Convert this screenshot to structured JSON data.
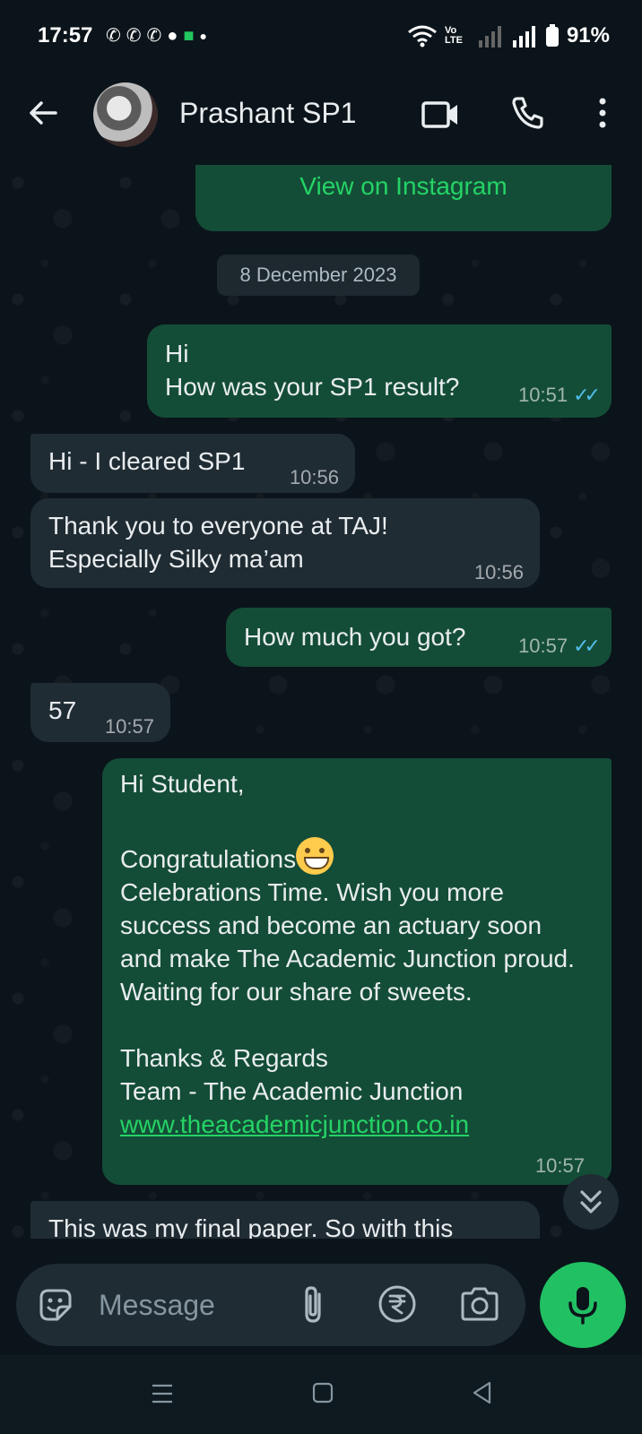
{
  "status_bar": {
    "time": "17:57",
    "notification_icons": [
      "whatsapp-icon",
      "whatsapp-icon",
      "whatsapp-business-icon",
      "chat-icon",
      "app-icon",
      "dot-icon"
    ],
    "network": "Vo LTE",
    "battery": "91%"
  },
  "header": {
    "contact_name": "Prashant SP1"
  },
  "chat": {
    "instagram_link": "View on Instagram",
    "date_chip": "8 December 2023",
    "messages": [
      {
        "dir": "out",
        "text": "Hi\nHow was your SP1 result?",
        "time": "10:51",
        "status": "read"
      },
      {
        "dir": "in",
        "text": "Hi - I cleared SP1",
        "time": "10:56"
      },
      {
        "dir": "in",
        "text": "Thank you to everyone at TAJ!\nEspecially Silky ma’am",
        "time": "10:56"
      },
      {
        "dir": "out",
        "text": "How much you got?",
        "time": "10:57",
        "status": "read"
      },
      {
        "dir": "in",
        "text": "57",
        "time": "10:57"
      },
      {
        "dir": "out",
        "greeting": "Hi Student,",
        "congrats": "Congratulations",
        "body": "Celebrations Time. Wish you more success and become an actuary soon and make The Academic Junction proud.\nWaiting for our share of sweets.\n\nThanks & Regards\nTeam - The Academic Junction",
        "link": "www.theacademicjunction.co.in",
        "time": "10:57"
      },
      {
        "dir": "in",
        "text": "This was my final paper. So with this"
      }
    ]
  },
  "composer": {
    "placeholder": "Message"
  },
  "colors": {
    "background": "#0b141a",
    "outgoing_bubble": "#144d37",
    "incoming_bubble": "#202c33",
    "accent": "#25d366",
    "read_ticks": "#53bdeb"
  }
}
